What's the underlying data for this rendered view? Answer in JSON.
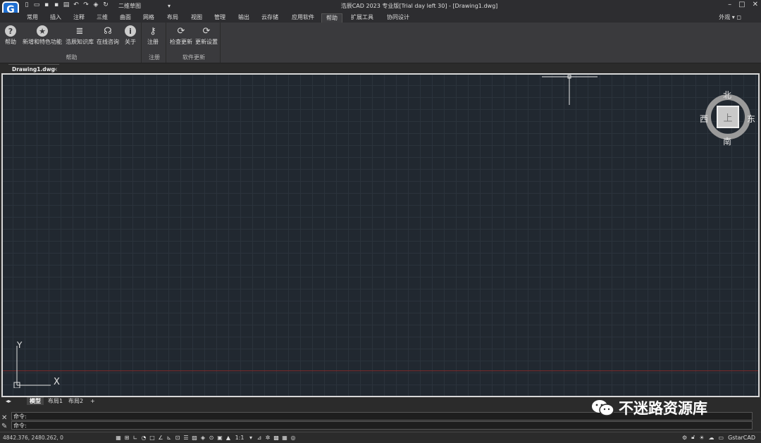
{
  "app": {
    "logo_letter": "G",
    "window_title": "浩辰CAD 2023 专业版[Trial day left 30] - [Drawing1.dwg]",
    "workspace": "二维草图",
    "appearance_label": "外观"
  },
  "menu_tabs": [
    "常用",
    "插入",
    "注释",
    "三维",
    "曲面",
    "网格",
    "布局",
    "视图",
    "管理",
    "输出",
    "云存储",
    "应用软件",
    "帮助",
    "扩展工具",
    "协同设计"
  ],
  "active_tab": "帮助",
  "ribbon": {
    "groups": [
      {
        "label": "帮助",
        "buttons": [
          "帮助",
          "新增和特色功能",
          "浩辰知识库",
          "在线咨询",
          "关于"
        ]
      },
      {
        "label": "注册",
        "buttons": [
          "注册"
        ]
      },
      {
        "label": "软件更新",
        "buttons": [
          "检查更新",
          "更新设置"
        ]
      }
    ]
  },
  "document_tab": {
    "name": "Drawing1.dwg"
  },
  "viewcube": {
    "top": "上",
    "north": "北",
    "south": "南",
    "east": "东",
    "west": "西"
  },
  "ucs": {
    "x": "X",
    "y": "Y"
  },
  "layout_tabs": [
    "模型",
    "布局1",
    "布局2"
  ],
  "command": {
    "line1": "命令:",
    "line2": "命令:"
  },
  "watermark": "不迷路资源库",
  "status": {
    "coords": "4842.376, 2480.262, 0",
    "scale": "1:1",
    "brand": "GstarCAD"
  },
  "colors": {
    "canvas_bg": "#212830",
    "accent": "#1f6fd1"
  }
}
